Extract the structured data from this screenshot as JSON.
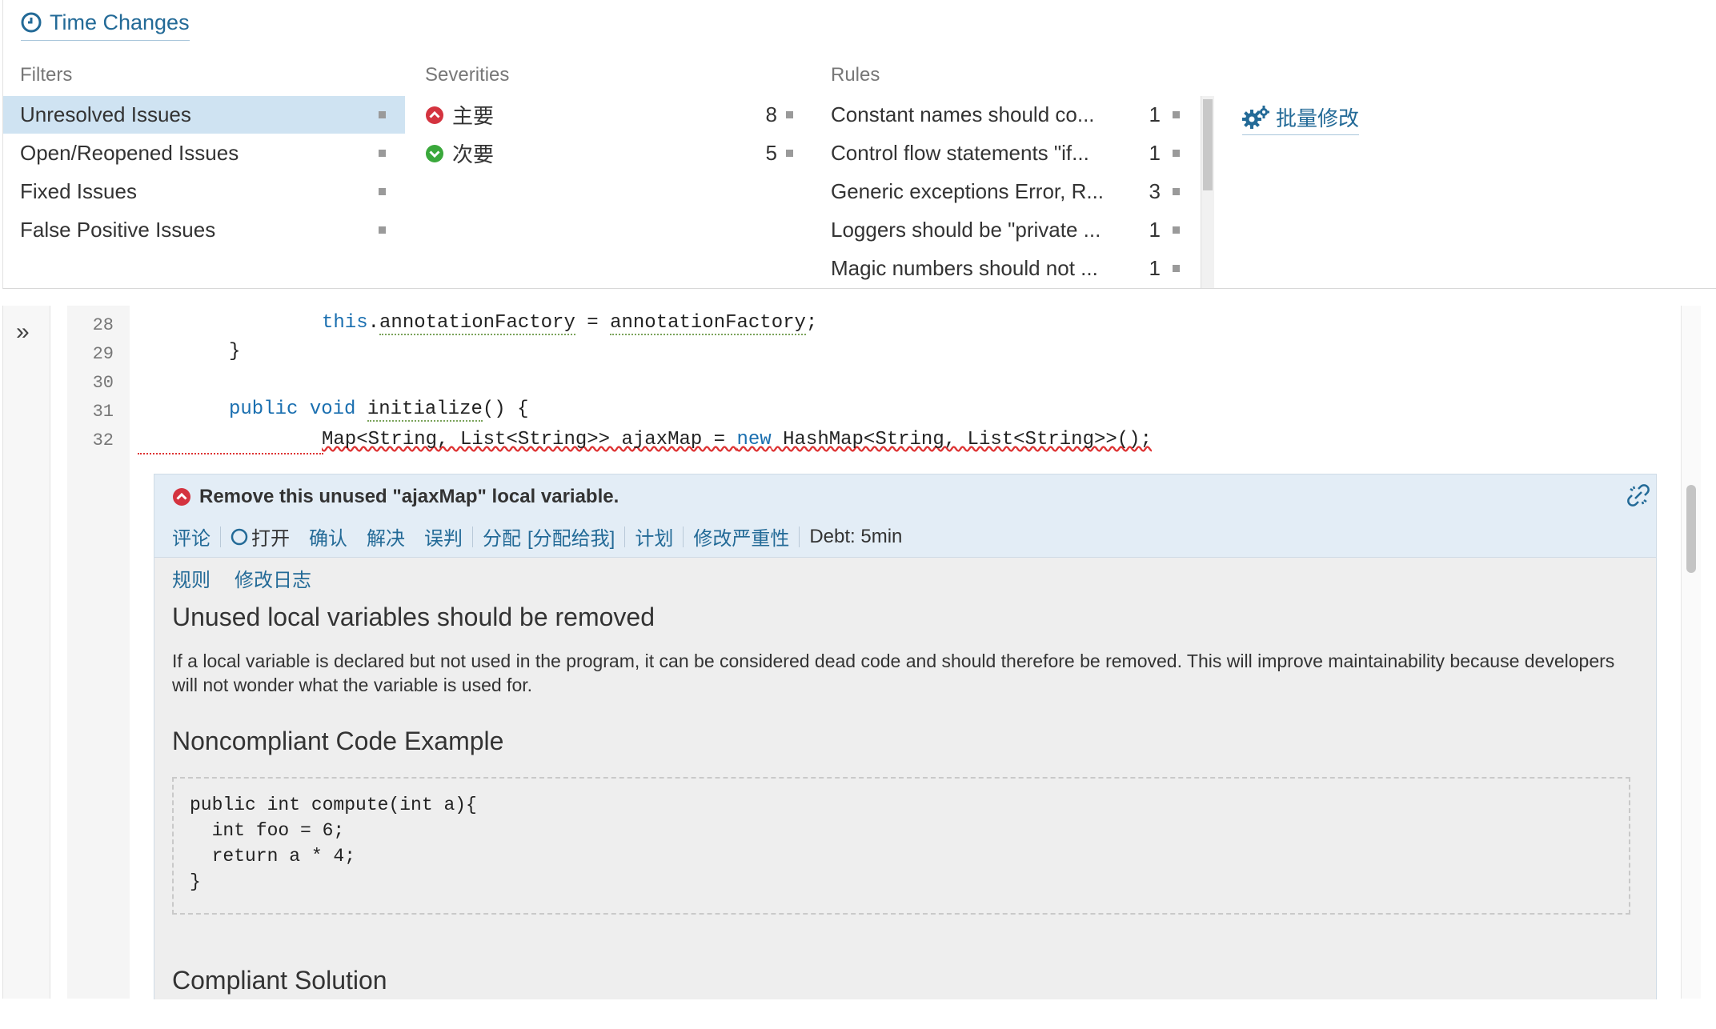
{
  "time_changes": {
    "label": "Time Changes",
    "icon": "clock-icon"
  },
  "filters": {
    "title": "Filters",
    "items": [
      {
        "label": "Unresolved Issues",
        "selected": true
      },
      {
        "label": "Open/Reopened Issues"
      },
      {
        "label": "Fixed Issues"
      },
      {
        "label": "False Positive Issues"
      }
    ]
  },
  "severities": {
    "title": "Severities",
    "items": [
      {
        "label": "主要",
        "count": "8",
        "icon": "major-severity-icon",
        "color": "#d4333f"
      },
      {
        "label": "次要",
        "count": "5",
        "icon": "minor-severity-icon",
        "color": "#3aa83b"
      }
    ]
  },
  "rules": {
    "title": "Rules",
    "items": [
      {
        "label": "Constant names should co...",
        "count": "1"
      },
      {
        "label": "Control flow statements \"if...",
        "count": "1"
      },
      {
        "label": "Generic exceptions Error, R...",
        "count": "3"
      },
      {
        "label": "Loggers should be \"private ...",
        "count": "1"
      },
      {
        "label": "Magic numbers should not ...",
        "count": "1"
      }
    ]
  },
  "bulk_change": {
    "label": "批量修改",
    "icon": "gears-icon"
  },
  "expand_icon": "double-chevron-right-icon",
  "source": {
    "lines": [
      {
        "num": "28",
        "code": "this.annotationFactory = annotationFactory;"
      },
      {
        "num": "29",
        "code": "}"
      },
      {
        "num": "30",
        "code": ""
      },
      {
        "num": "31",
        "code": "public void initialize() {"
      },
      {
        "num": "32",
        "code": "Map<String, List<String>> ajaxMap = new HashMap<String, List<String>>();"
      }
    ],
    "tokens": {
      "l28_this": "this",
      "l28_dot": ".",
      "l28_field": "annotationFactory",
      "l28_eq": " = ",
      "l28_val": "annotationFactory",
      "l28_semi": ";",
      "l29": "}",
      "l31_kw1": "public",
      "l31_kw2": "void",
      "l31_name": "initialize",
      "l31_rest": "() {",
      "l32_a": "Map<String, List<String>> ajaxMap = ",
      "l32_new": "new",
      "l32_b": " HashMap<String, List<String>>();"
    }
  },
  "issue": {
    "message": "Remove this unused \"ajaxMap\" local variable.",
    "severity_icon": "major-severity-icon",
    "link_icon": "unlink-icon",
    "actions": {
      "comment": "评论",
      "status": "打开",
      "confirm": "确认",
      "resolve": "解决",
      "false_positive": "误判",
      "assign": "分配",
      "assign_me": "[分配给我]",
      "plan": "计划",
      "change_severity": "修改严重性",
      "debt": "Debt: 5min"
    },
    "tabs": {
      "rule": "规则",
      "changelog": "修改日志"
    },
    "rule_title": "Unused local variables should be removed",
    "rule_description": "If a local variable is declared but not used in the program, it can be considered dead code and should therefore be removed. This will improve maintainability because developers will not wonder what the variable is used for.",
    "noncompliant_title": "Noncompliant Code Example",
    "noncompliant_code": [
      "public int compute(int a){",
      "  int foo = 6;",
      "  return a * 4;",
      "}"
    ],
    "compliant_title": "Compliant Solution"
  }
}
